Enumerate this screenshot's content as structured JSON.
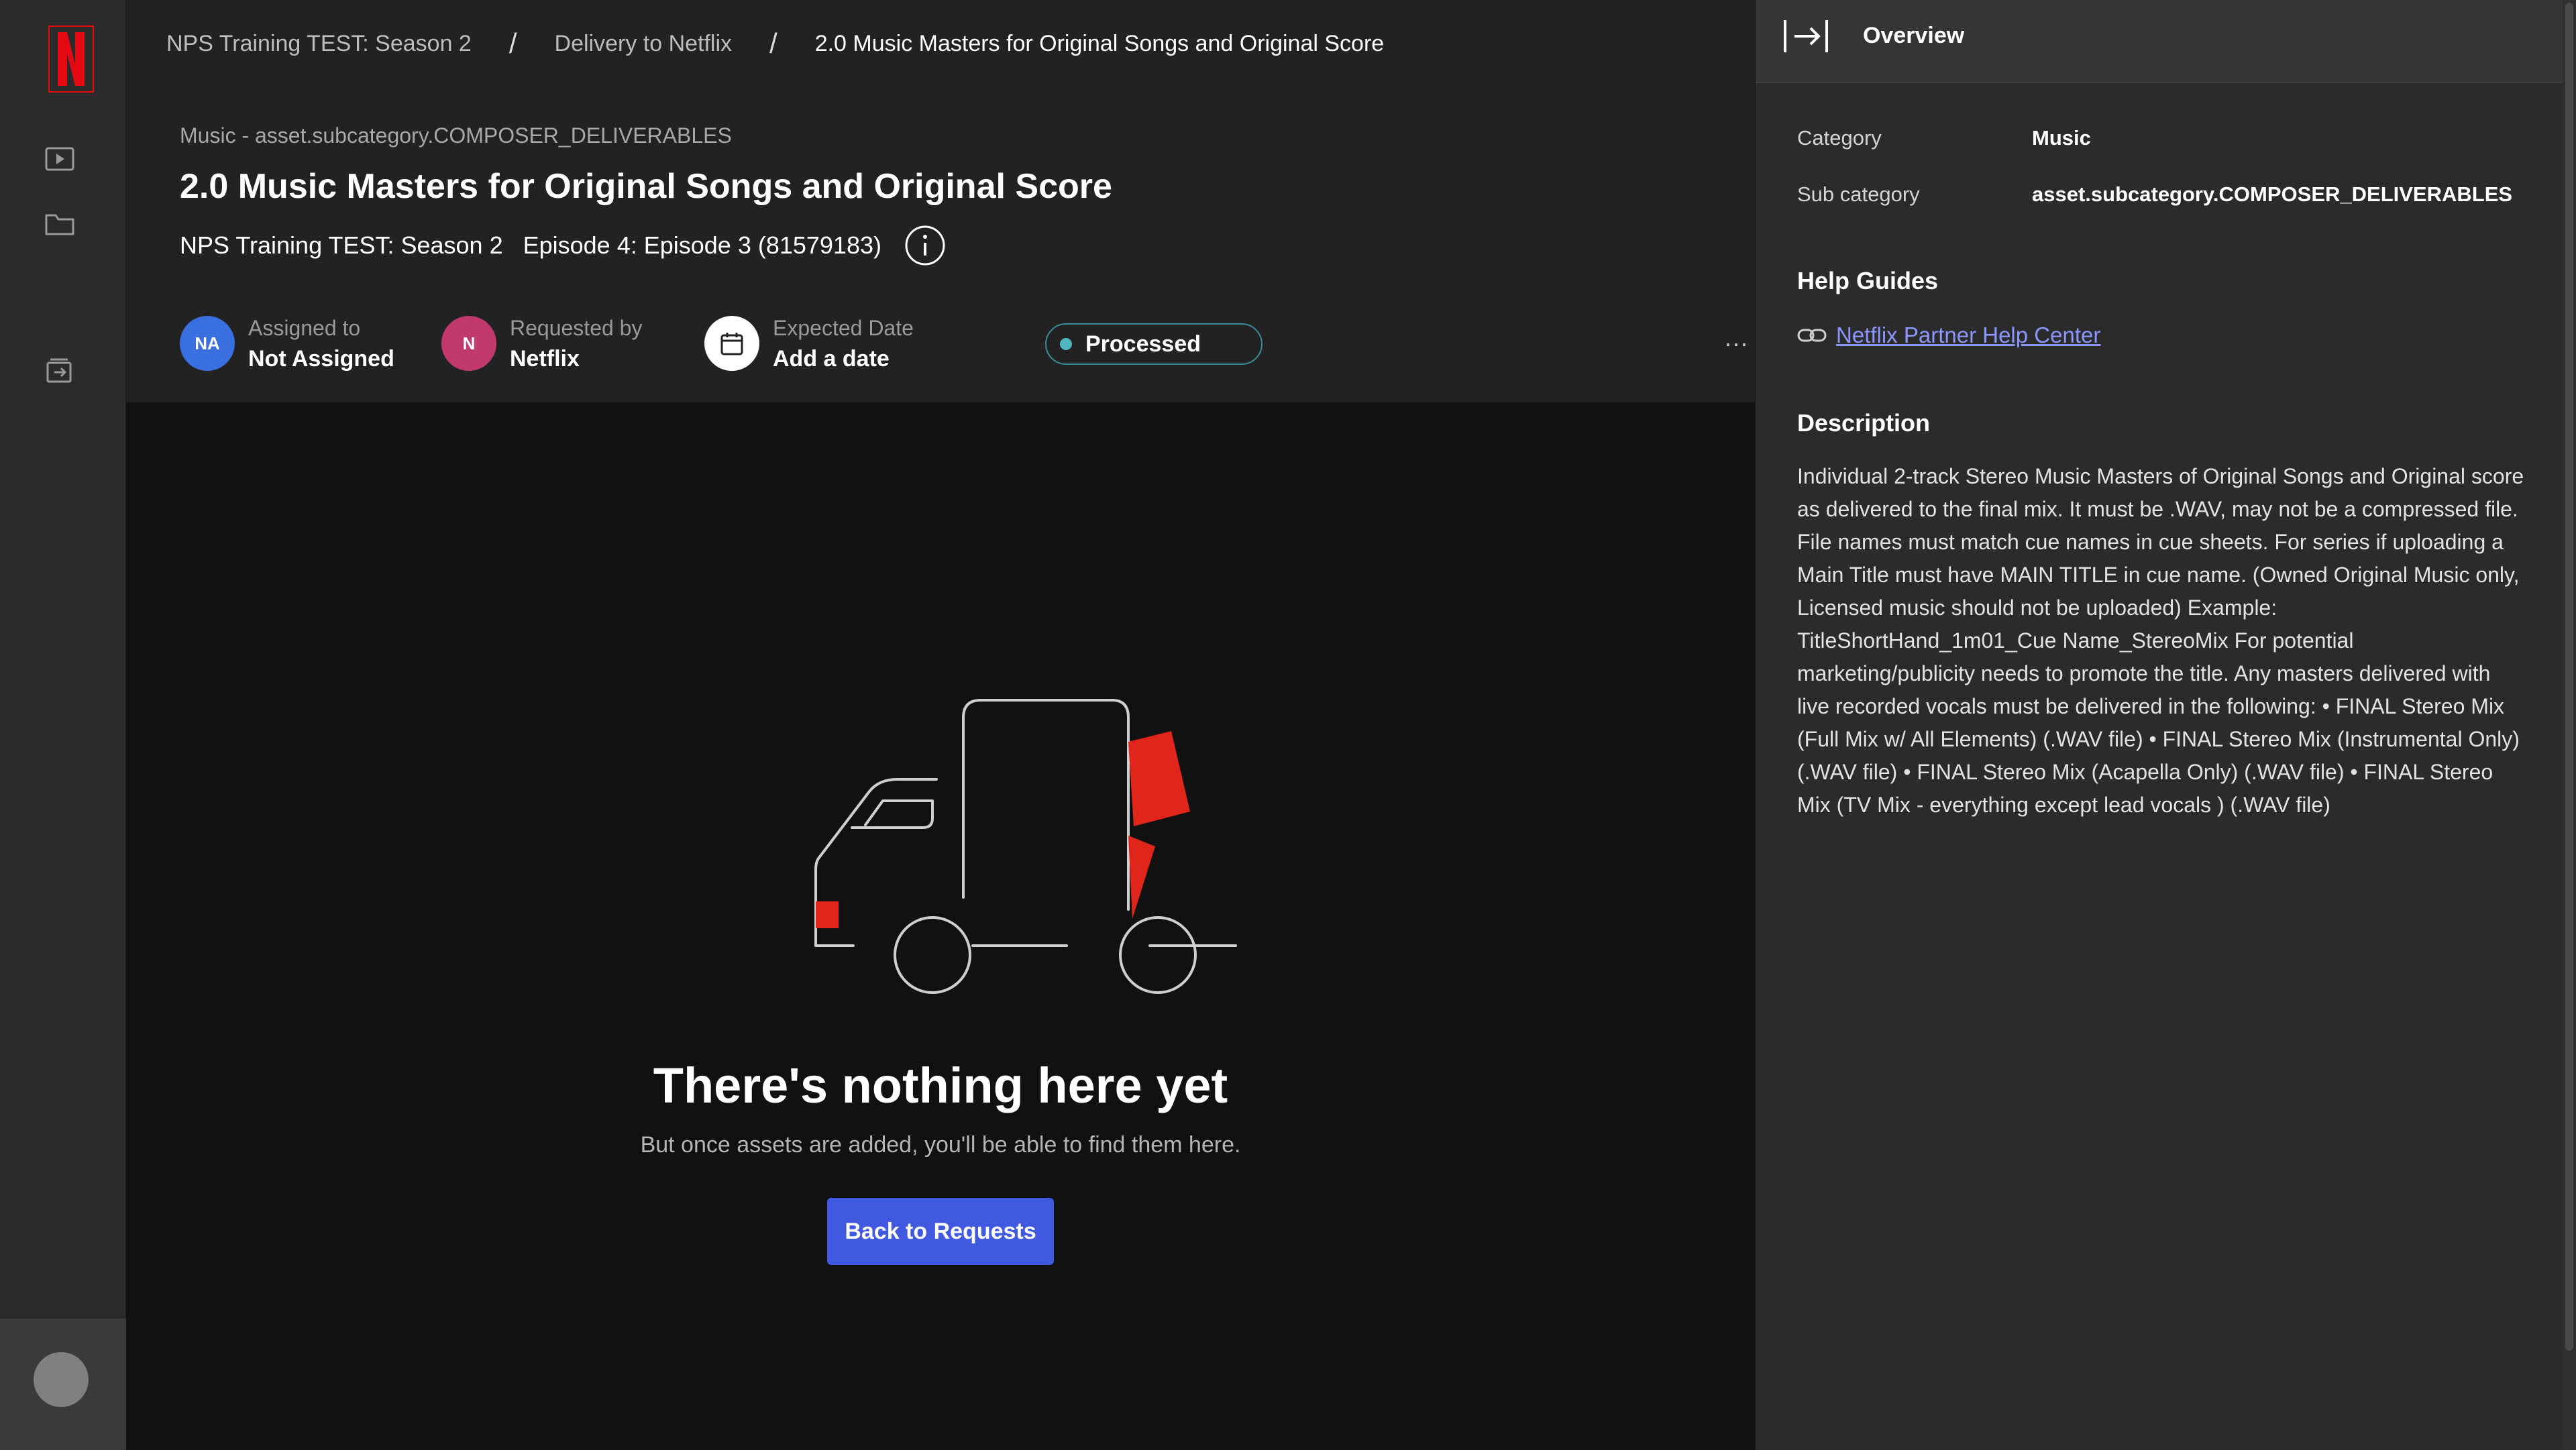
{
  "breadcrumb": [
    "NPS Training TEST: Season 2",
    "Delivery to Netflix",
    "2.0 Music Masters for Original Songs and Original Score"
  ],
  "breadcrumb_separator": "/",
  "asset": {
    "subcategory_line": "Music - asset.subcategory.COMPOSER_DELIVERABLES",
    "title": "2.0 Music Masters for Original Songs and Original Score",
    "show": "NPS Training TEST: Season 2",
    "episode": "Episode 4: Episode 3 (81579183)"
  },
  "meta": {
    "assigned": {
      "initials": "NA",
      "label": "Assigned to",
      "value": "Not Assigned",
      "color": "#3a6fe0"
    },
    "requested": {
      "initials": "N",
      "label": "Requested by",
      "value": "Netflix",
      "color": "#c23a6d"
    },
    "expected": {
      "label": "Expected Date",
      "value": "Add a date"
    },
    "status": {
      "label": "Processed",
      "color": "#4fb6be"
    },
    "more_label": "···"
  },
  "empty_state": {
    "title": "There's nothing here yet",
    "subtitle": "But once assets are added, you'll be able to find them here.",
    "button": "Back to Requests"
  },
  "panel": {
    "title": "Overview",
    "category_label": "Category",
    "category_value": "Music",
    "subcategory_label": "Sub category",
    "subcategory_value": "asset.subcategory.COMPOSER_DELIVERABLES",
    "help_title": "Help Guides",
    "help_link": "Netflix Partner Help Center",
    "description_title": "Description",
    "description": "Individual 2-track Stereo Music Masters of Original Songs and Original score as delivered to the final mix. It must be .WAV, may not be a compressed file. File names must match cue names in cue sheets. For series if uploading a Main Title must have MAIN TITLE in cue name. (Owned Original Music only, Licensed music should not be uploaded) Example: TitleShortHand_1m01_Cue Name_StereoMix For potential marketing/publicity needs to promote the title. Any masters delivered with live recorded vocals must be delivered in the following: • FINAL Stereo Mix (Full Mix w/ All Elements) (.WAV file) • FINAL Stereo Mix (Instrumental Only) (.WAV file) • FINAL Stereo Mix (Acapella Only) (.WAV file) • FINAL Stereo Mix (TV Mix - everything except lead vocals ) (.WAV file)"
  },
  "icons": {
    "rail": [
      "netflix-logo",
      "play-icon",
      "folder-icon",
      "deliveries-icon",
      "user-avatar"
    ],
    "header": [
      "info-icon",
      "calendar-icon",
      "more-icon"
    ],
    "panel": [
      "collapse-panel-icon",
      "link-icon"
    ]
  },
  "colors": {
    "brand_red": "#e50914",
    "accent_blue": "#4158e0",
    "link": "#8c96ff"
  }
}
